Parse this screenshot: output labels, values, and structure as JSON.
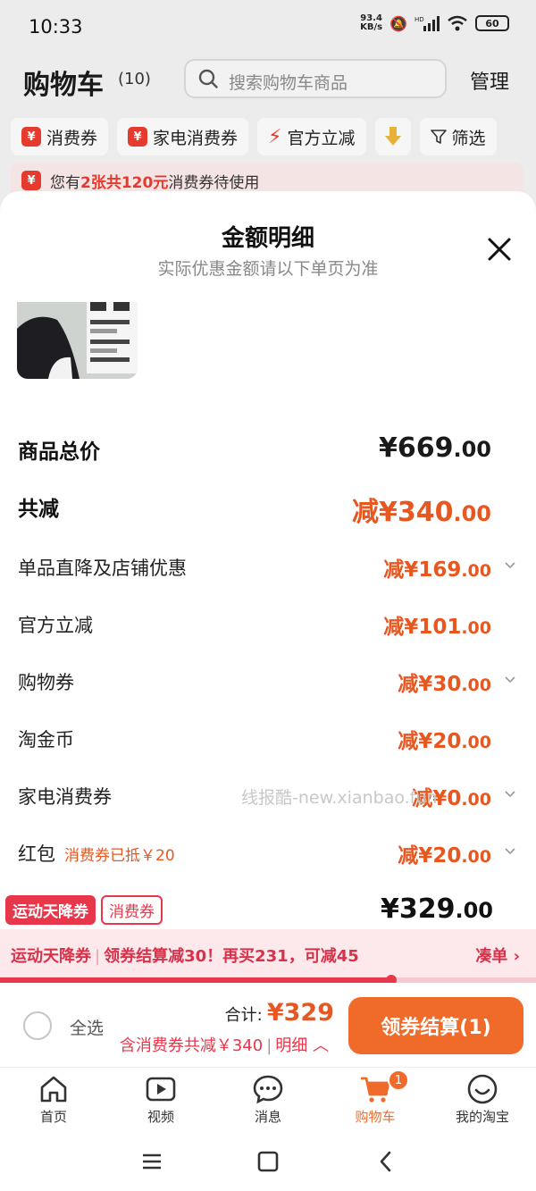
{
  "status": {
    "time": "10:33",
    "net_speed_top": "93.4",
    "net_speed_bottom": "KB/s",
    "battery": "60"
  },
  "header": {
    "title": "购物车",
    "count": "(10)",
    "search_placeholder": "搜索购物车商品",
    "manage": "管理"
  },
  "filters": [
    {
      "label": "消费券",
      "icon": "yen-icon"
    },
    {
      "label": "家电消费券",
      "icon": "yen-icon"
    },
    {
      "label": "官方立减",
      "icon": "bolt-icon"
    },
    {
      "label": "筛选",
      "icon": "funnel-icon"
    }
  ],
  "notice": {
    "prefix": "您有",
    "highlight": "2张共120元",
    "suffix": "消费券待使用"
  },
  "sheet": {
    "title": "金额明细",
    "subtitle": "实际优惠金额请以下单页为准",
    "rows": [
      {
        "label": "商品总价",
        "sym": "¥",
        "int": "669",
        "dec": ".00"
      },
      {
        "label": "共减",
        "sym": "减¥",
        "int": "340",
        "dec": ".00"
      },
      {
        "label": "单品直降及店铺优惠",
        "sym": "减¥",
        "int": "169",
        "dec": ".00"
      },
      {
        "label": "官方立减",
        "sym": "减¥",
        "int": "101",
        "dec": ".00"
      },
      {
        "label": "购物券",
        "sym": "减¥",
        "int": "30",
        "dec": ".00"
      },
      {
        "label": "淘金币",
        "sym": "减¥",
        "int": "20",
        "dec": ".00"
      },
      {
        "label": "家电消费券",
        "sym": "减¥",
        "int": "0",
        "dec": ".00"
      },
      {
        "label": "红包",
        "sub": "消费券已抵￥20",
        "sym": "减¥",
        "int": "20",
        "dec": ".00"
      }
    ],
    "watermark": "线报酷-new.xianbao.fun"
  },
  "promo": {
    "tag1": "运动天降券",
    "tag2": "消费券",
    "total_sym": "¥",
    "total_int": "329",
    "total_dec": ".00",
    "bar_tag": "运动天降券",
    "bar_text": "领券结算减30！再买231，可减45",
    "bar_link": "凑单 ›",
    "progress": 0.73
  },
  "checkout": {
    "select_all": "全选",
    "sum_label": "合计:",
    "sum_value": "¥329",
    "detail_text": "含消费券共减￥340",
    "detail_link": "明细 ︿",
    "pay_button": "领券结算(1)"
  },
  "tabs": [
    {
      "label": "首页",
      "icon": "home-icon"
    },
    {
      "label": "视频",
      "icon": "video-icon"
    },
    {
      "label": "消息",
      "icon": "message-icon"
    },
    {
      "label": "购物车",
      "icon": "cart-icon",
      "badge": "1"
    },
    {
      "label": "我的淘宝",
      "icon": "profile-icon"
    }
  ],
  "colors": {
    "accent": "#f06b2a",
    "discount": "#e8571f",
    "promo_red": "#e8364a"
  }
}
